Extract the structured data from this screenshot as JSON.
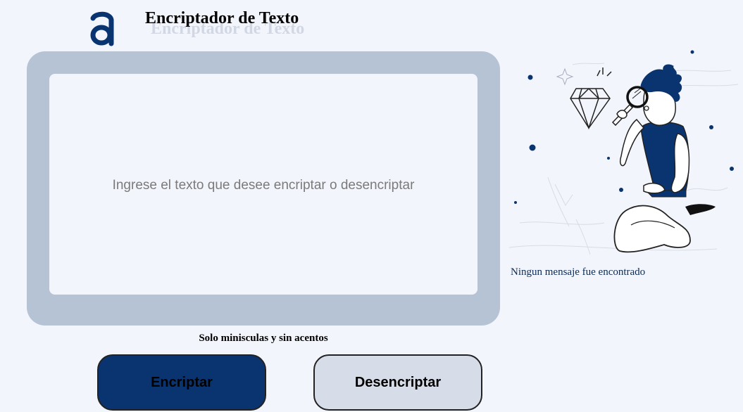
{
  "header": {
    "title": "Encriptador de Texto",
    "logo_icon": "alura-a-logo-icon"
  },
  "editor": {
    "placeholder": "Ingrese el texto que desee encriptar o desencriptar",
    "value": ""
  },
  "hint": "Solo minisculas y sin acentos",
  "buttons": {
    "encrypt_label": "Encriptar",
    "decrypt_label": "Desencriptar"
  },
  "output": {
    "illustration": "person-with-magnifying-glass-and-diamond-illustration",
    "empty_message": "Ningun mensaje fue encontrado"
  },
  "colors": {
    "background": "#f3f5fc",
    "primary": "#0a3470",
    "frame": "#b6c3d5",
    "secondary_button": "#d7dde8"
  }
}
